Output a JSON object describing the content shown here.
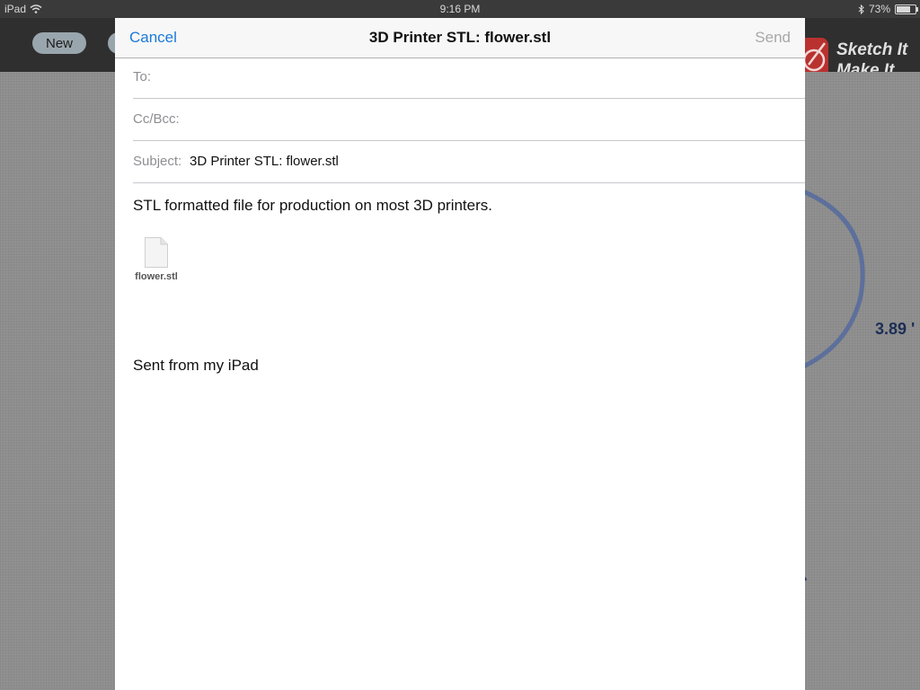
{
  "status_bar": {
    "device": "iPad",
    "time": "9:16 PM",
    "battery": "73%",
    "battery_level": 0.73
  },
  "app": {
    "new_button": "New",
    "logo_line1": "Sketch It",
    "logo_line2": "Make It",
    "dimension": "3.89 '"
  },
  "compose": {
    "cancel": "Cancel",
    "title": "3D Printer STL: flower.stl",
    "send": "Send",
    "to_label": "To:",
    "cc_label": "Cc/Bcc:",
    "subject_label": "Subject:",
    "subject_value": "3D Printer STL: flower.stl",
    "body": "STL formatted file for production on most 3D printers.",
    "attachment_name": "flower.stl",
    "signature": "Sent from my iPad"
  }
}
